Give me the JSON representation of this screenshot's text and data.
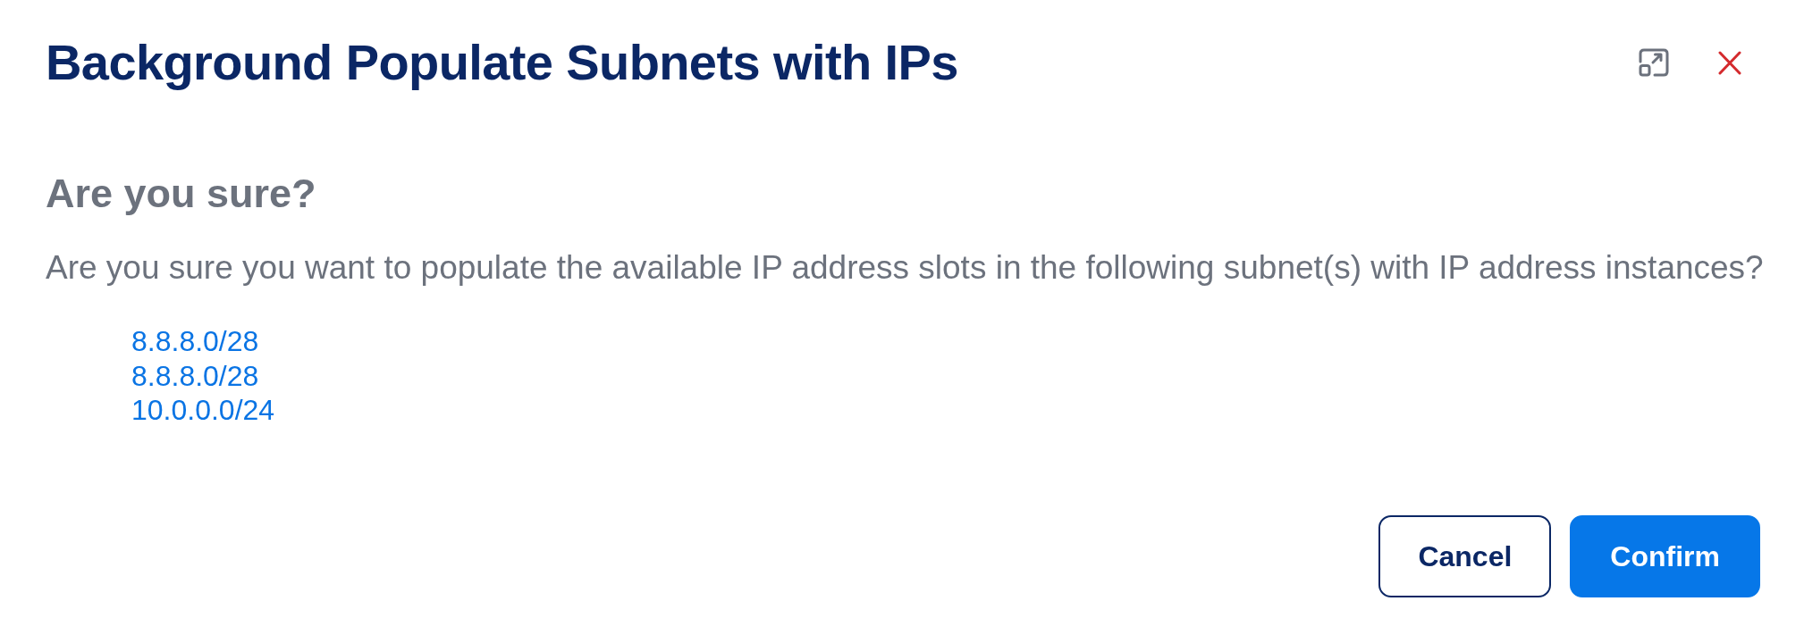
{
  "dialog": {
    "title": "Background Populate Subnets with IPs",
    "heading": "Are you sure?",
    "message": "Are you sure you want to populate the available IP address slots in the following subnet(s) with IP address instances?",
    "subnets": [
      "8.8.8.0/28",
      "8.8.8.0/28",
      "10.0.0.0/24"
    ],
    "buttons": [
      {
        "label": "Cancel",
        "kind": "secondary"
      },
      {
        "label": "Confirm",
        "kind": "primary"
      }
    ]
  }
}
